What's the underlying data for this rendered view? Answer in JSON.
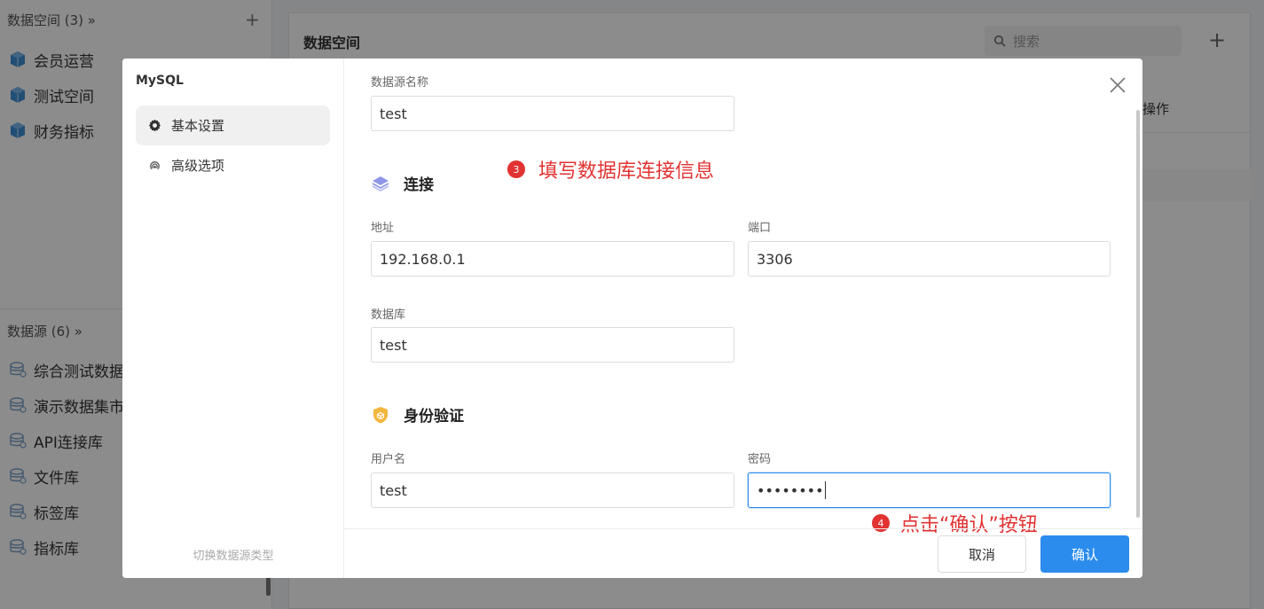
{
  "left_panel": {
    "spaces_header": "数据空间 (3) »",
    "add_symbol": "+",
    "spaces": [
      {
        "label": "会员运营"
      },
      {
        "label": "测试空间"
      },
      {
        "label": "财务指标"
      }
    ],
    "sources_header": "数据源 (6) »",
    "sources": [
      {
        "label": "综合测试数据"
      },
      {
        "label": "演示数据集市"
      },
      {
        "label": "API连接库"
      },
      {
        "label": "文件库"
      },
      {
        "label": "标签库"
      },
      {
        "label": "指标库"
      }
    ]
  },
  "content": {
    "title": "数据空间",
    "search_placeholder": "搜索",
    "add_symbol": "+",
    "operation_column": "操作"
  },
  "modal": {
    "source_type": "MySQL",
    "nav": [
      {
        "label": "基本设置",
        "active": true
      },
      {
        "label": "高级选项",
        "active": false
      }
    ],
    "switch_type": "切换数据源类型",
    "name_label": "数据源名称",
    "name_value": "test",
    "connection_title": "连接",
    "address_label": "地址",
    "address_value": "192.168.0.1",
    "port_label": "端口",
    "port_value": "3306",
    "database_label": "数据库",
    "database_value": "test",
    "auth_title": "身份验证",
    "username_label": "用户名",
    "username_value": "test",
    "password_label": "密码",
    "password_value": "••••••••",
    "cancel_label": "取消",
    "confirm_label": "确认"
  },
  "annotations": {
    "step3_number": "3",
    "step3_text": "填写数据库连接信息",
    "step4_number": "4",
    "step4_text": "点击“确认”按钮"
  },
  "colors": {
    "primary": "#2b8cee",
    "annotation": "#e23232",
    "cube": "#3d8fd6",
    "layers": "#8f96e8",
    "shield": "#f4b73e"
  }
}
